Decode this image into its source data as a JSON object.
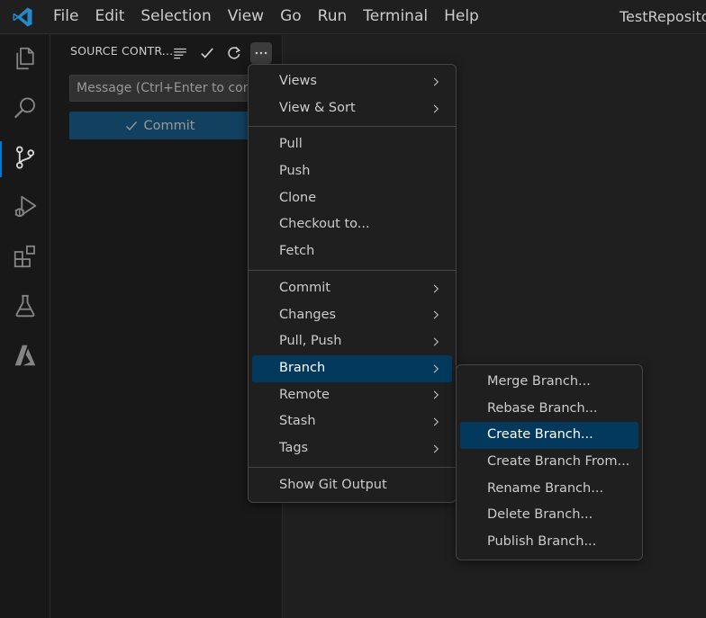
{
  "menubar": {
    "items": [
      "File",
      "Edit",
      "Selection",
      "View",
      "Go",
      "Run",
      "Terminal",
      "Help"
    ],
    "window_title": "TestRepositor"
  },
  "activitybar": {
    "icons": [
      "explorer-icon",
      "search-icon",
      "source-control-icon",
      "run-debug-icon",
      "extensions-icon",
      "testing-icon",
      "azure-icon"
    ]
  },
  "sidebar": {
    "title": "SOURCE CONTR...",
    "message_placeholder": "Message (Ctrl+Enter to comm",
    "commit_label": "Commit"
  },
  "context_menu": {
    "groups": [
      [
        {
          "label": "Views",
          "submenu": true
        },
        {
          "label": "View & Sort",
          "submenu": true
        }
      ],
      [
        {
          "label": "Pull",
          "submenu": false
        },
        {
          "label": "Push",
          "submenu": false
        },
        {
          "label": "Clone",
          "submenu": false
        },
        {
          "label": "Checkout to...",
          "submenu": false
        },
        {
          "label": "Fetch",
          "submenu": false
        }
      ],
      [
        {
          "label": "Commit",
          "submenu": true
        },
        {
          "label": "Changes",
          "submenu": true
        },
        {
          "label": "Pull, Push",
          "submenu": true
        },
        {
          "label": "Branch",
          "submenu": true,
          "selected": true
        },
        {
          "label": "Remote",
          "submenu": true
        },
        {
          "label": "Stash",
          "submenu": true
        },
        {
          "label": "Tags",
          "submenu": true
        }
      ],
      [
        {
          "label": "Show Git Output",
          "submenu": false
        }
      ]
    ]
  },
  "branch_submenu": {
    "items": [
      {
        "label": "Merge Branch..."
      },
      {
        "label": "Rebase Branch..."
      },
      {
        "label": "Create Branch...",
        "selected": true
      },
      {
        "label": "Create Branch From..."
      },
      {
        "label": "Rename Branch..."
      },
      {
        "label": "Delete Branch..."
      },
      {
        "label": "Publish Branch..."
      }
    ]
  },
  "colors": {
    "accent": "#0078d4",
    "selection": "#04395e",
    "commit_button": "#0e639c"
  }
}
